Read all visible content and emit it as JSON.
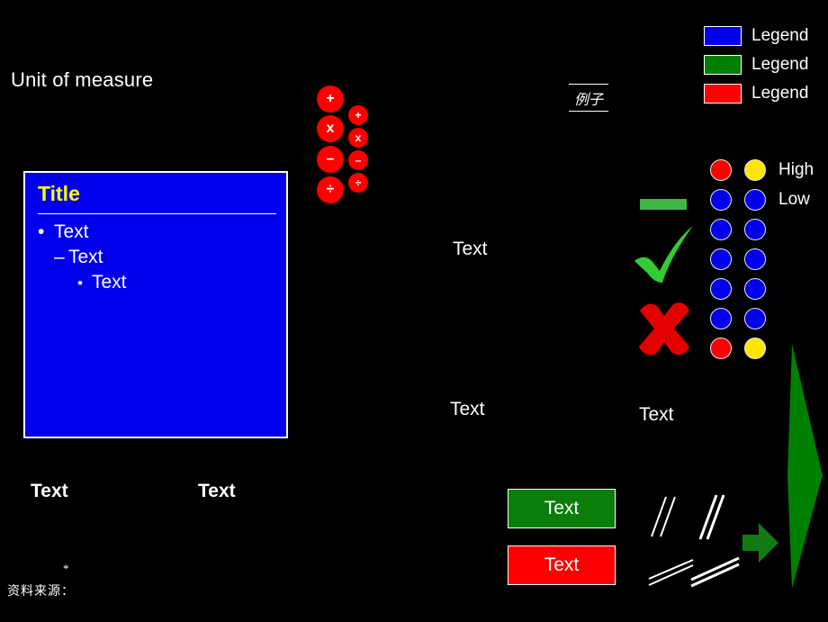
{
  "slide": {
    "background_color": "#000000",
    "unit_of_measure": "Unit of measure",
    "source_note": "资料来源：",
    "footnote_asterisk": "*"
  },
  "content_box": {
    "title": "Title",
    "fill_color": "#0000EE",
    "title_color": "#FFFF00",
    "border_color": "#FFFFFF",
    "bullets": [
      {
        "marker": "•",
        "label": "Text",
        "level": 1
      },
      {
        "marker": "–",
        "label": "Text",
        "level": 2
      },
      {
        "marker": "•",
        "label": "Text",
        "level": 3
      }
    ]
  },
  "bold_labels": [
    {
      "label": "Text"
    },
    {
      "label": "Text"
    }
  ],
  "plain_labels": [
    {
      "label": "Text"
    },
    {
      "label": "Text"
    },
    {
      "label": "Text"
    }
  ],
  "operator_icons": {
    "fill_color": "#FF0000",
    "glyph_color": "#FFFFFF",
    "large": [
      {
        "symbol": "+",
        "icon": "plus-icon"
      },
      {
        "symbol": "x",
        "icon": "multiply-icon"
      },
      {
        "symbol": "–",
        "icon": "minus-icon"
      },
      {
        "symbol": "÷",
        "icon": "divide-icon"
      }
    ],
    "small": [
      {
        "symbol": "+",
        "icon": "plus-icon"
      },
      {
        "symbol": "x",
        "icon": "multiply-icon"
      },
      {
        "symbol": "–",
        "icon": "minus-icon"
      },
      {
        "symbol": "÷",
        "icon": "divide-icon"
      }
    ]
  },
  "legend": {
    "items": [
      {
        "color": "#0000EE",
        "label": "Legend"
      },
      {
        "color": "#007F00",
        "label": "Legend"
      },
      {
        "color": "#FF0000",
        "label": "Legend"
      }
    ]
  },
  "example_stamp": {
    "label": "例子"
  },
  "status_marks": {
    "dash_color": "#3CB843",
    "check_color": "#33CC33",
    "cross_color": "#E50000"
  },
  "dot_matrix": {
    "scale_high_label": "High",
    "scale_low_label": "Low",
    "colors": {
      "high": "#FF0000",
      "mid": "#FFE500",
      "low": "#0000EE"
    },
    "rows": [
      {
        "left": "red",
        "right": "yellow",
        "label": "High"
      },
      {
        "left": "blue",
        "right": "blue",
        "label": "Low"
      },
      {
        "left": "blue",
        "right": "blue",
        "label": ""
      },
      {
        "left": "blue",
        "right": "blue",
        "label": ""
      },
      {
        "left": "blue",
        "right": "blue",
        "label": ""
      },
      {
        "left": "blue",
        "right": "blue",
        "label": ""
      },
      {
        "left": "red",
        "right": "yellow",
        "label": ""
      }
    ]
  },
  "color_buttons": [
    {
      "label": "Text",
      "color": "#0B7D0B"
    },
    {
      "label": "Text",
      "color": "#FF0000"
    }
  ],
  "shapes": {
    "arrow_color": "#127A12",
    "wedge_color": "#007F00",
    "break_mark_color": "#FFFFFF"
  }
}
